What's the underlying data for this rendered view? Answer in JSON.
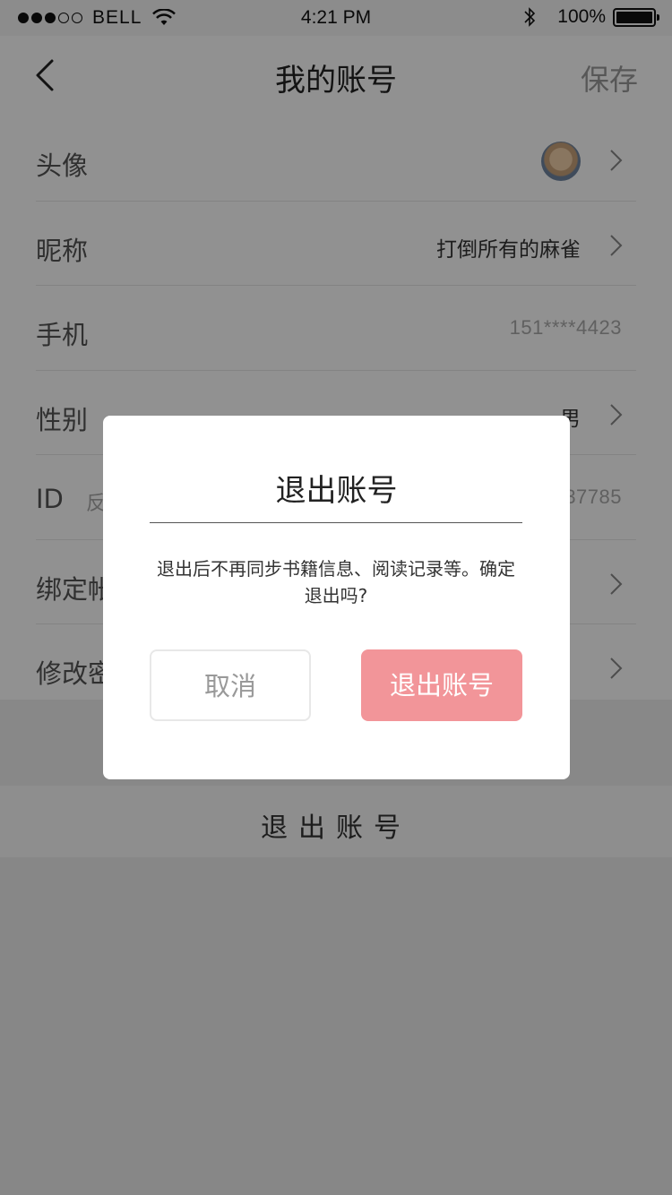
{
  "status_bar": {
    "carrier": "BELL",
    "time": "4:21 PM",
    "battery": "100%"
  },
  "nav": {
    "title": "我的账号",
    "save_label": "保存"
  },
  "rows": [
    {
      "label": "头像",
      "value": ""
    },
    {
      "label": "昵称",
      "value": "打倒所有的麻雀"
    },
    {
      "label": "手机",
      "value": "151****4423"
    },
    {
      "label": "性别",
      "value": "男"
    },
    {
      "label": "ID",
      "sub": "反",
      "value": "37785"
    },
    {
      "label": "绑定帐",
      "value": ""
    },
    {
      "label": "修改密",
      "value": ""
    }
  ],
  "logout_bar_label": "退出账号",
  "dialog": {
    "title": "退出账号",
    "message": "退出后不再同步书籍信息、阅读记录等。确定退出吗?",
    "cancel_label": "取消",
    "confirm_label": "退出账号"
  },
  "colors": {
    "confirm_button": "#f29599",
    "overlay": "rgba(0,0,0,0.43)"
  }
}
